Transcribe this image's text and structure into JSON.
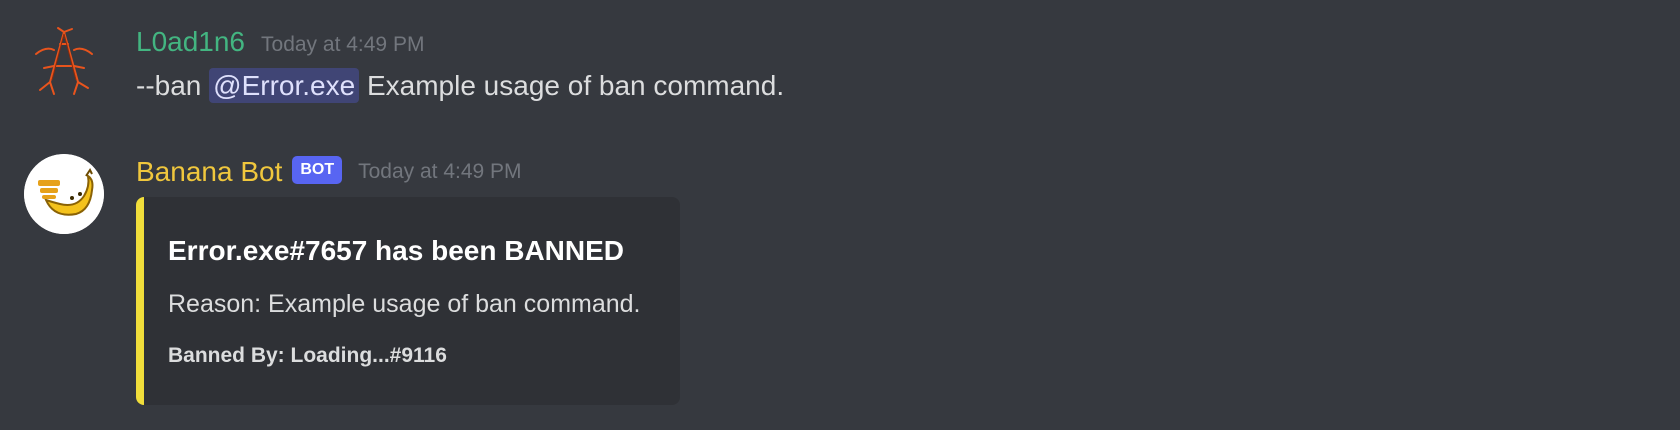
{
  "messages": [
    {
      "username": "L0ad1n6",
      "timestamp": "Today at 4:49 PM",
      "content_prefix": "--ban",
      "mention": "@Error.exe",
      "content_suffix": "Example usage of ban command."
    },
    {
      "username": "Banana Bot",
      "badge": "BOT",
      "timestamp": "Today at 4:49 PM",
      "embed": {
        "title": "Error.exe#7657 has been BANNED",
        "description": "Reason: Example usage of ban command.",
        "footer": "Banned By: Loading...#9116"
      }
    }
  ],
  "colors": {
    "background": "#36393f",
    "username_1": "#43b581",
    "username_2": "#f0c73d",
    "embed_accent": "#f1de3b",
    "bot_badge": "#5865f2"
  }
}
